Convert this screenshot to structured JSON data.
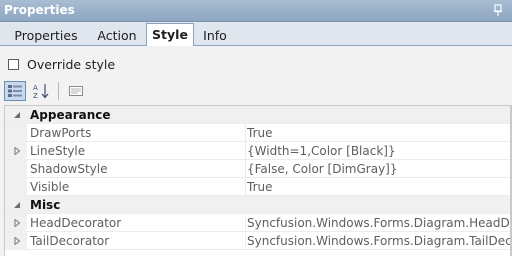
{
  "panel": {
    "title": "Properties"
  },
  "tabs": [
    {
      "label": "Properties",
      "active": false
    },
    {
      "label": "Action",
      "active": false
    },
    {
      "label": "Style",
      "active": true
    },
    {
      "label": "Info",
      "active": false
    }
  ],
  "override": {
    "label": "Override style",
    "checked": false
  },
  "grid": {
    "categories": [
      {
        "name": "Appearance",
        "rows": [
          {
            "name": "DrawPorts",
            "value": "True",
            "expandable": false
          },
          {
            "name": "LineStyle",
            "value": "{Width=1,Color [Black]}",
            "expandable": true
          },
          {
            "name": "ShadowStyle",
            "value": "{False, Color [DimGray]}",
            "expandable": false
          },
          {
            "name": "Visible",
            "value": "True",
            "expandable": false
          }
        ]
      },
      {
        "name": "Misc",
        "rows": [
          {
            "name": "HeadDecorator",
            "value": "Syncfusion.Windows.Forms.Diagram.HeadDecorator",
            "expandable": true
          },
          {
            "name": "TailDecorator",
            "value": "Syncfusion.Windows.Forms.Diagram.TailDecorator",
            "expandable": true
          }
        ]
      }
    ]
  },
  "icons": {
    "pin": "pin-icon",
    "categorized": "categorized-view-icon",
    "alphabetical": "alphabetical-sort-icon",
    "property_pages": "property-pages-icon"
  },
  "colors": {
    "accent": "#8ea6c1",
    "tab_border": "#8ea3bc"
  }
}
